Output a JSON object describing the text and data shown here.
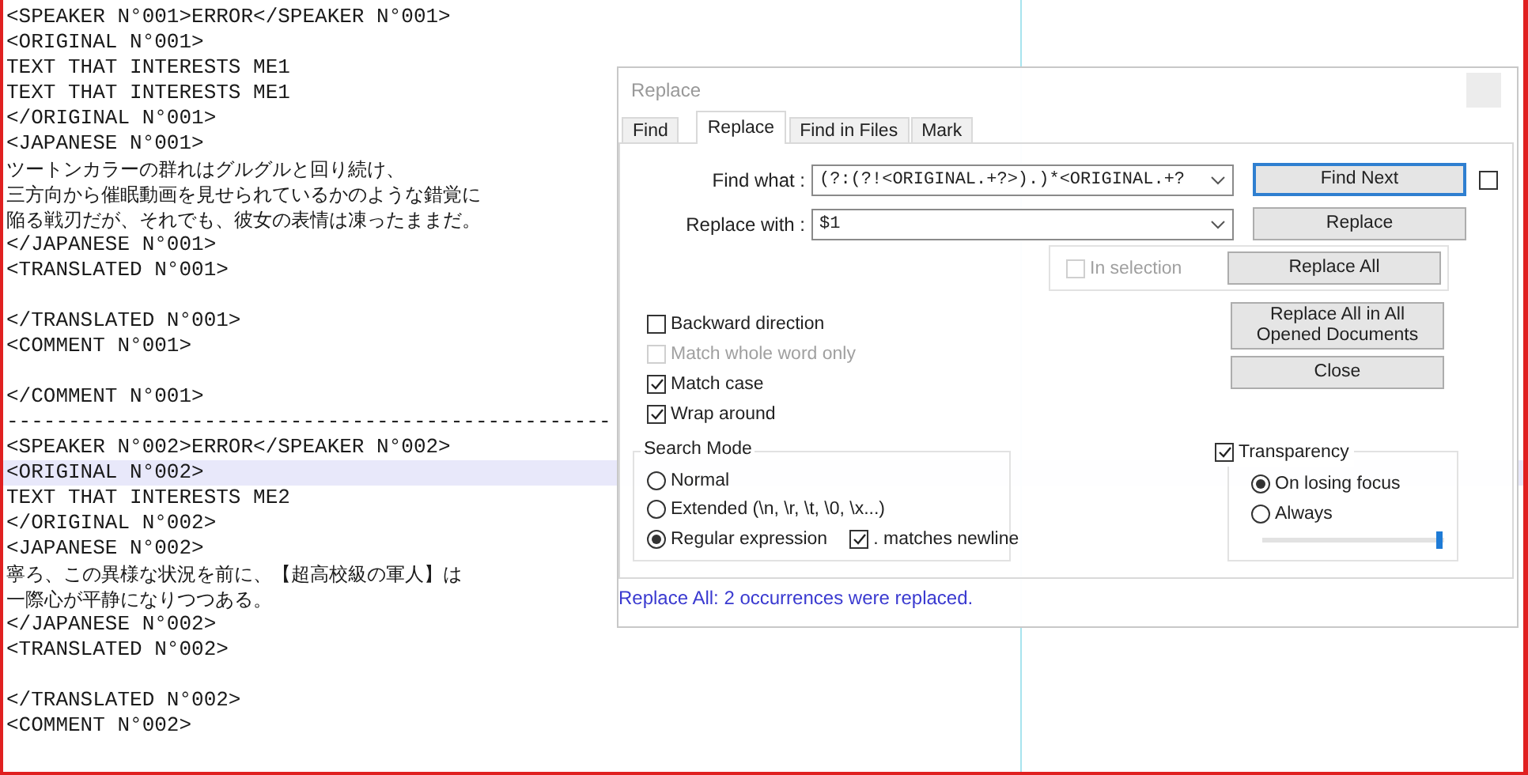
{
  "editor": {
    "lines": [
      {
        "text": "<SPEAKER N°001>ERROR</SPEAKER N°001>",
        "kind": "code",
        "current": false
      },
      {
        "text": "<ORIGINAL N°001>",
        "kind": "code",
        "current": false
      },
      {
        "text": "TEXT THAT INTERESTS ME1",
        "kind": "code",
        "current": false
      },
      {
        "text": "TEXT THAT INTERESTS ME1",
        "kind": "code",
        "current": false
      },
      {
        "text": "</ORIGINAL N°001>",
        "kind": "code",
        "current": false
      },
      {
        "text": "<JAPANESE N°001>",
        "kind": "code",
        "current": false
      },
      {
        "text": "ツートンカラーの群れはグルグルと回り続け、",
        "kind": "prose",
        "current": false
      },
      {
        "text": "三方向から催眠動画を見せられているかのような錯覚に",
        "kind": "prose",
        "current": false
      },
      {
        "text": "陥る戦刃だが、それでも、彼女の表情は凍ったままだ。",
        "kind": "prose",
        "current": false
      },
      {
        "text": "</JAPANESE N°001>",
        "kind": "code",
        "current": false
      },
      {
        "text": "<TRANSLATED N°001>",
        "kind": "code",
        "current": false
      },
      {
        "kind": "blank",
        "current": false
      },
      {
        "text": "</TRANSLATED N°001>",
        "kind": "code",
        "current": false
      },
      {
        "text": "<COMMENT N°001>",
        "kind": "code",
        "current": false
      },
      {
        "kind": "blank",
        "current": false
      },
      {
        "text": "</COMMENT N°001>",
        "kind": "code",
        "current": false
      },
      {
        "text": "-------------------------------------------------",
        "kind": "code",
        "current": false
      },
      {
        "text": "<SPEAKER N°002>ERROR</SPEAKER N°002>",
        "kind": "code",
        "current": false
      },
      {
        "text": "<ORIGINAL N°002>",
        "kind": "code",
        "current": true
      },
      {
        "text": "TEXT THAT INTERESTS ME2",
        "kind": "code",
        "current": false
      },
      {
        "text": "</ORIGINAL N°002>",
        "kind": "code",
        "current": false
      },
      {
        "text": "<JAPANESE N°002>",
        "kind": "code",
        "current": false
      },
      {
        "text": "寧ろ、この異様な状況を前に、【超高校級の軍人】は",
        "kind": "prose",
        "current": false
      },
      {
        "text": "一際心が平静になりつつある。",
        "kind": "prose",
        "current": false
      },
      {
        "text": "</JAPANESE N°002>",
        "kind": "code",
        "current": false
      },
      {
        "text": "<TRANSLATED N°002>",
        "kind": "code",
        "current": false
      },
      {
        "kind": "blank",
        "current": false
      },
      {
        "text": "</TRANSLATED N°002>",
        "kind": "code",
        "current": false
      },
      {
        "text": "<COMMENT N°002>",
        "kind": "code",
        "current": false
      }
    ]
  },
  "dialog": {
    "title": "Replace",
    "tabs": [
      {
        "label": "Find",
        "selected": false
      },
      {
        "label": "Replace",
        "selected": true
      },
      {
        "label": "Find in Files",
        "selected": false
      },
      {
        "label": "Mark",
        "selected": false
      }
    ],
    "find_what": {
      "label": "Find what :",
      "value": "(?:(?!<ORIGINAL.+?>).)*<ORIGINAL.+?"
    },
    "replace_with": {
      "label": "Replace with :",
      "value": "$1"
    },
    "find_next_checkbox": {
      "checked": false
    },
    "in_selection": {
      "label": "In selection",
      "checked": false,
      "disabled": true
    },
    "buttons": [
      "Find Next",
      "Replace",
      "Replace All",
      "Replace All in All Opened Documents",
      "Close"
    ],
    "options": [
      {
        "label": "Backward direction",
        "checked": false,
        "disabled": false
      },
      {
        "label": "Match whole word only",
        "checked": false,
        "disabled": true
      },
      {
        "label": "Match case",
        "checked": true,
        "disabled": false
      },
      {
        "label": "Wrap around",
        "checked": true,
        "disabled": false
      }
    ],
    "search_mode": {
      "title": "Search Mode",
      "modes": [
        {
          "label": "Normal",
          "selected": false
        },
        {
          "label": "Extended (\\n, \\r, \\t, \\0, \\x...)",
          "selected": false
        },
        {
          "label": "Regular expression",
          "selected": true
        }
      ],
      "dot_matches_newline": {
        "label": ". matches newline",
        "checked": true
      }
    },
    "transparency": {
      "label": "Transparency",
      "checked": true,
      "modes": [
        {
          "label": "On losing focus",
          "selected": true
        },
        {
          "label": "Always",
          "selected": false
        }
      ],
      "level": 0.97
    },
    "status": "Replace All: 2 occurrences were replaced."
  }
}
